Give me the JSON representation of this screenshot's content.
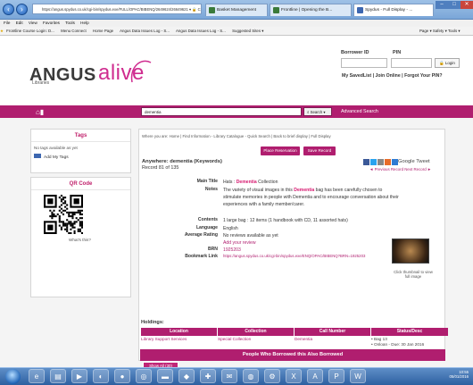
{
  "browser": {
    "address": "https://angus.spydus.co.uk/cgi-bin/spydus.exe/FULL/OPAC/BIBENQ/2649624/26649621 ▾ 🔒 C",
    "tabs": [
      {
        "label": "Basket Management"
      },
      {
        "label": "Frontline | Opening the B..."
      },
      {
        "label": "Spydus - Full Display - ..."
      }
    ],
    "menu": [
      "File",
      "Edit",
      "View",
      "Favorites",
      "Tools",
      "Help"
    ],
    "favorites": [
      "Frontline Course Login: D...",
      "Menu Connect",
      "Home Page",
      "Angus Data Issues Log - S...",
      "Angus Data Issues Log - S...",
      "Suggested Sites ▾"
    ],
    "right_tools": "Page ▾  Safety ▾  Tools ▾"
  },
  "site": {
    "logo_part1": "ANGUS",
    "logo_part2": "alive",
    "logo_sub": "Libraries",
    "borrower_label": "Borrower ID",
    "pin_label": "PIN",
    "login_button": "Login",
    "account_links": "My SavedList | Join Online | Forgot Your PIN?",
    "search_value": "dementia",
    "search_button": "Search ▾",
    "advanced_search": "Advanced Search"
  },
  "sidebar": {
    "tags_title": "Tags",
    "tags_empty": "No tags available as yet",
    "add_tags": "Add My Tags",
    "qr_title": "QR Code",
    "qr_help": "What's this?"
  },
  "record": {
    "breadcrumb": "Where you are: Home  |  Find Information - Library Catalogue - Quick Search  |  Back to brief display  |  Full Display",
    "place_reservation": "Place Reservation",
    "save_record": "Save Record",
    "anywhere": "Anywhere: dementia (Keywords)",
    "record_count": "Record 81 of 135",
    "prev_next": "◄ Previous Record  Next Record ►",
    "share_text": "Google  Tweet",
    "thumb_caption": "Click thumbnail to view full image",
    "fields": [
      {
        "label": "Main Title",
        "pre": "Hats : ",
        "hl": "Dementia",
        "post": " Collection"
      },
      {
        "label": "Notes",
        "pre": "The variety of visual images in this ",
        "hl": "Dementia",
        "post": " bag has been carefully chosen to stimulate memories in people with Dementia and to encourage conversation about their experiences with a family member/carer."
      },
      {
        "label": "Contents",
        "pre": "1 large bag : 12 items (1 handbook with CD, 11 assorted hats)",
        "hl": "",
        "post": ""
      },
      {
        "label": "Language",
        "pre": "English",
        "hl": "",
        "post": ""
      },
      {
        "label": "Average Rating",
        "pre": "No reviews available as yet",
        "hl": "",
        "post": ""
      },
      {
        "label": "",
        "pre": "Add your review",
        "hl": "",
        "post": ""
      },
      {
        "label": "BRN",
        "pre": "1925203",
        "hl": "",
        "post": ""
      },
      {
        "label": "Bookmark Link",
        "pre": "https://angus.spydus.co.uk/cgi-bin/spydus.exe/ENQ/OPAC/BIBENQ?BRN=1925203",
        "hl": "",
        "post": ""
      }
    ],
    "holdings_title": "Holdings:",
    "holdings_headers": [
      "Location",
      "Collection",
      "Call Number",
      "Status/Desc"
    ],
    "holdings_row": [
      "Library Support Services",
      "Special Collection",
      "Dementia",
      "• Bag 13\n• Onloan - Due: 30 Jan 2016"
    ],
    "people_title": "People Who Borrowed this Also Borrowed",
    "show_all": "Show All (30)"
  },
  "taskbar": {
    "clock": "10:55\n05/01/2016"
  }
}
